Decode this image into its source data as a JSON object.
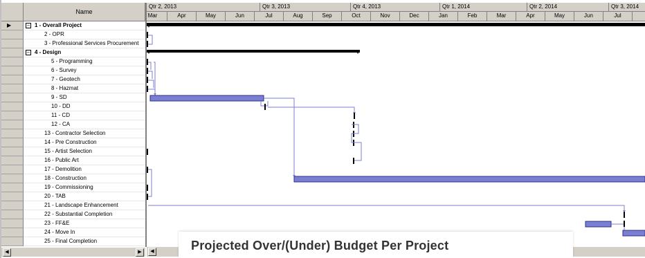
{
  "grid": {
    "name_header": "Name",
    "rows": [
      {
        "id": "1",
        "label": "1 - Overall Project",
        "level": 0,
        "bold": true,
        "expander": "minus",
        "current": true
      },
      {
        "id": "2",
        "label": "2 - OPR",
        "level": 2
      },
      {
        "id": "3",
        "label": "3 - Professional Services Procurement",
        "level": 2
      },
      {
        "id": "4",
        "label": "4 - Design",
        "level": 0,
        "bold": true,
        "expander": "minus"
      },
      {
        "id": "5",
        "label": "5 - Programming",
        "level": 3
      },
      {
        "id": "6",
        "label": "6 - Survey",
        "level": 3
      },
      {
        "id": "7",
        "label": "7 - Geotech",
        "level": 3
      },
      {
        "id": "8",
        "label": "8 - Hazmat",
        "level": 3
      },
      {
        "id": "9",
        "label": "9 - SD",
        "level": 3
      },
      {
        "id": "10",
        "label": "10 - DD",
        "level": 3
      },
      {
        "id": "11",
        "label": "11 - CD",
        "level": 3
      },
      {
        "id": "12",
        "label": "12 - CA",
        "level": 3
      },
      {
        "id": "13",
        "label": "13 - Contractor Selection",
        "level": 2
      },
      {
        "id": "14",
        "label": "14 - Pre Construction",
        "level": 2
      },
      {
        "id": "15",
        "label": "15 - Artist Selection",
        "level": 2
      },
      {
        "id": "16",
        "label": "16 - Public Art",
        "level": 2
      },
      {
        "id": "17",
        "label": "17 - Demolition",
        "level": 2
      },
      {
        "id": "18",
        "label": "18 - Construction",
        "level": 2
      },
      {
        "id": "19",
        "label": "19 - Commissioning",
        "level": 2
      },
      {
        "id": "20",
        "label": "20 - TAB",
        "level": 2
      },
      {
        "id": "21",
        "label": "21 - Landscape Enhancement",
        "level": 2
      },
      {
        "id": "22",
        "label": "22 - Substantial Completion",
        "level": 2
      },
      {
        "id": "23",
        "label": "23 - FF&E",
        "level": 2
      },
      {
        "id": "24",
        "label": "24 - Move In",
        "level": 2
      },
      {
        "id": "25",
        "label": "25 - Final Completion",
        "level": 2
      }
    ],
    "current_row_marker": "▶",
    "expander_symbol": "−"
  },
  "timescale": {
    "quarters": [
      "Qtr 2, 2013",
      "Qtr 3, 2013",
      "Qtr 4, 2013",
      "Qtr 1, 2014",
      "Qtr 2, 2014",
      "Qtr 3, 2014"
    ],
    "months": [
      "Mar",
      "Apr",
      "May",
      "Jun",
      "Jul",
      "Aug",
      "Sep",
      "Oct",
      "Nov",
      "Dec",
      "Jan",
      "Feb",
      "Mar",
      "Apr",
      "May",
      "Jun",
      "Jul"
    ]
  },
  "colors": {
    "task_bar": "#7b7fd1",
    "task_bar_border": "#2b2f8a",
    "summary_bar": "#000000",
    "link_line": "#7b7fd1",
    "chrome": "#d4d0c8"
  },
  "scroll": {
    "left_arrow": "◀",
    "right_arrow": "▶"
  },
  "overlay": {
    "caption": "Projected Over/(Under) Budget Per Project"
  }
}
